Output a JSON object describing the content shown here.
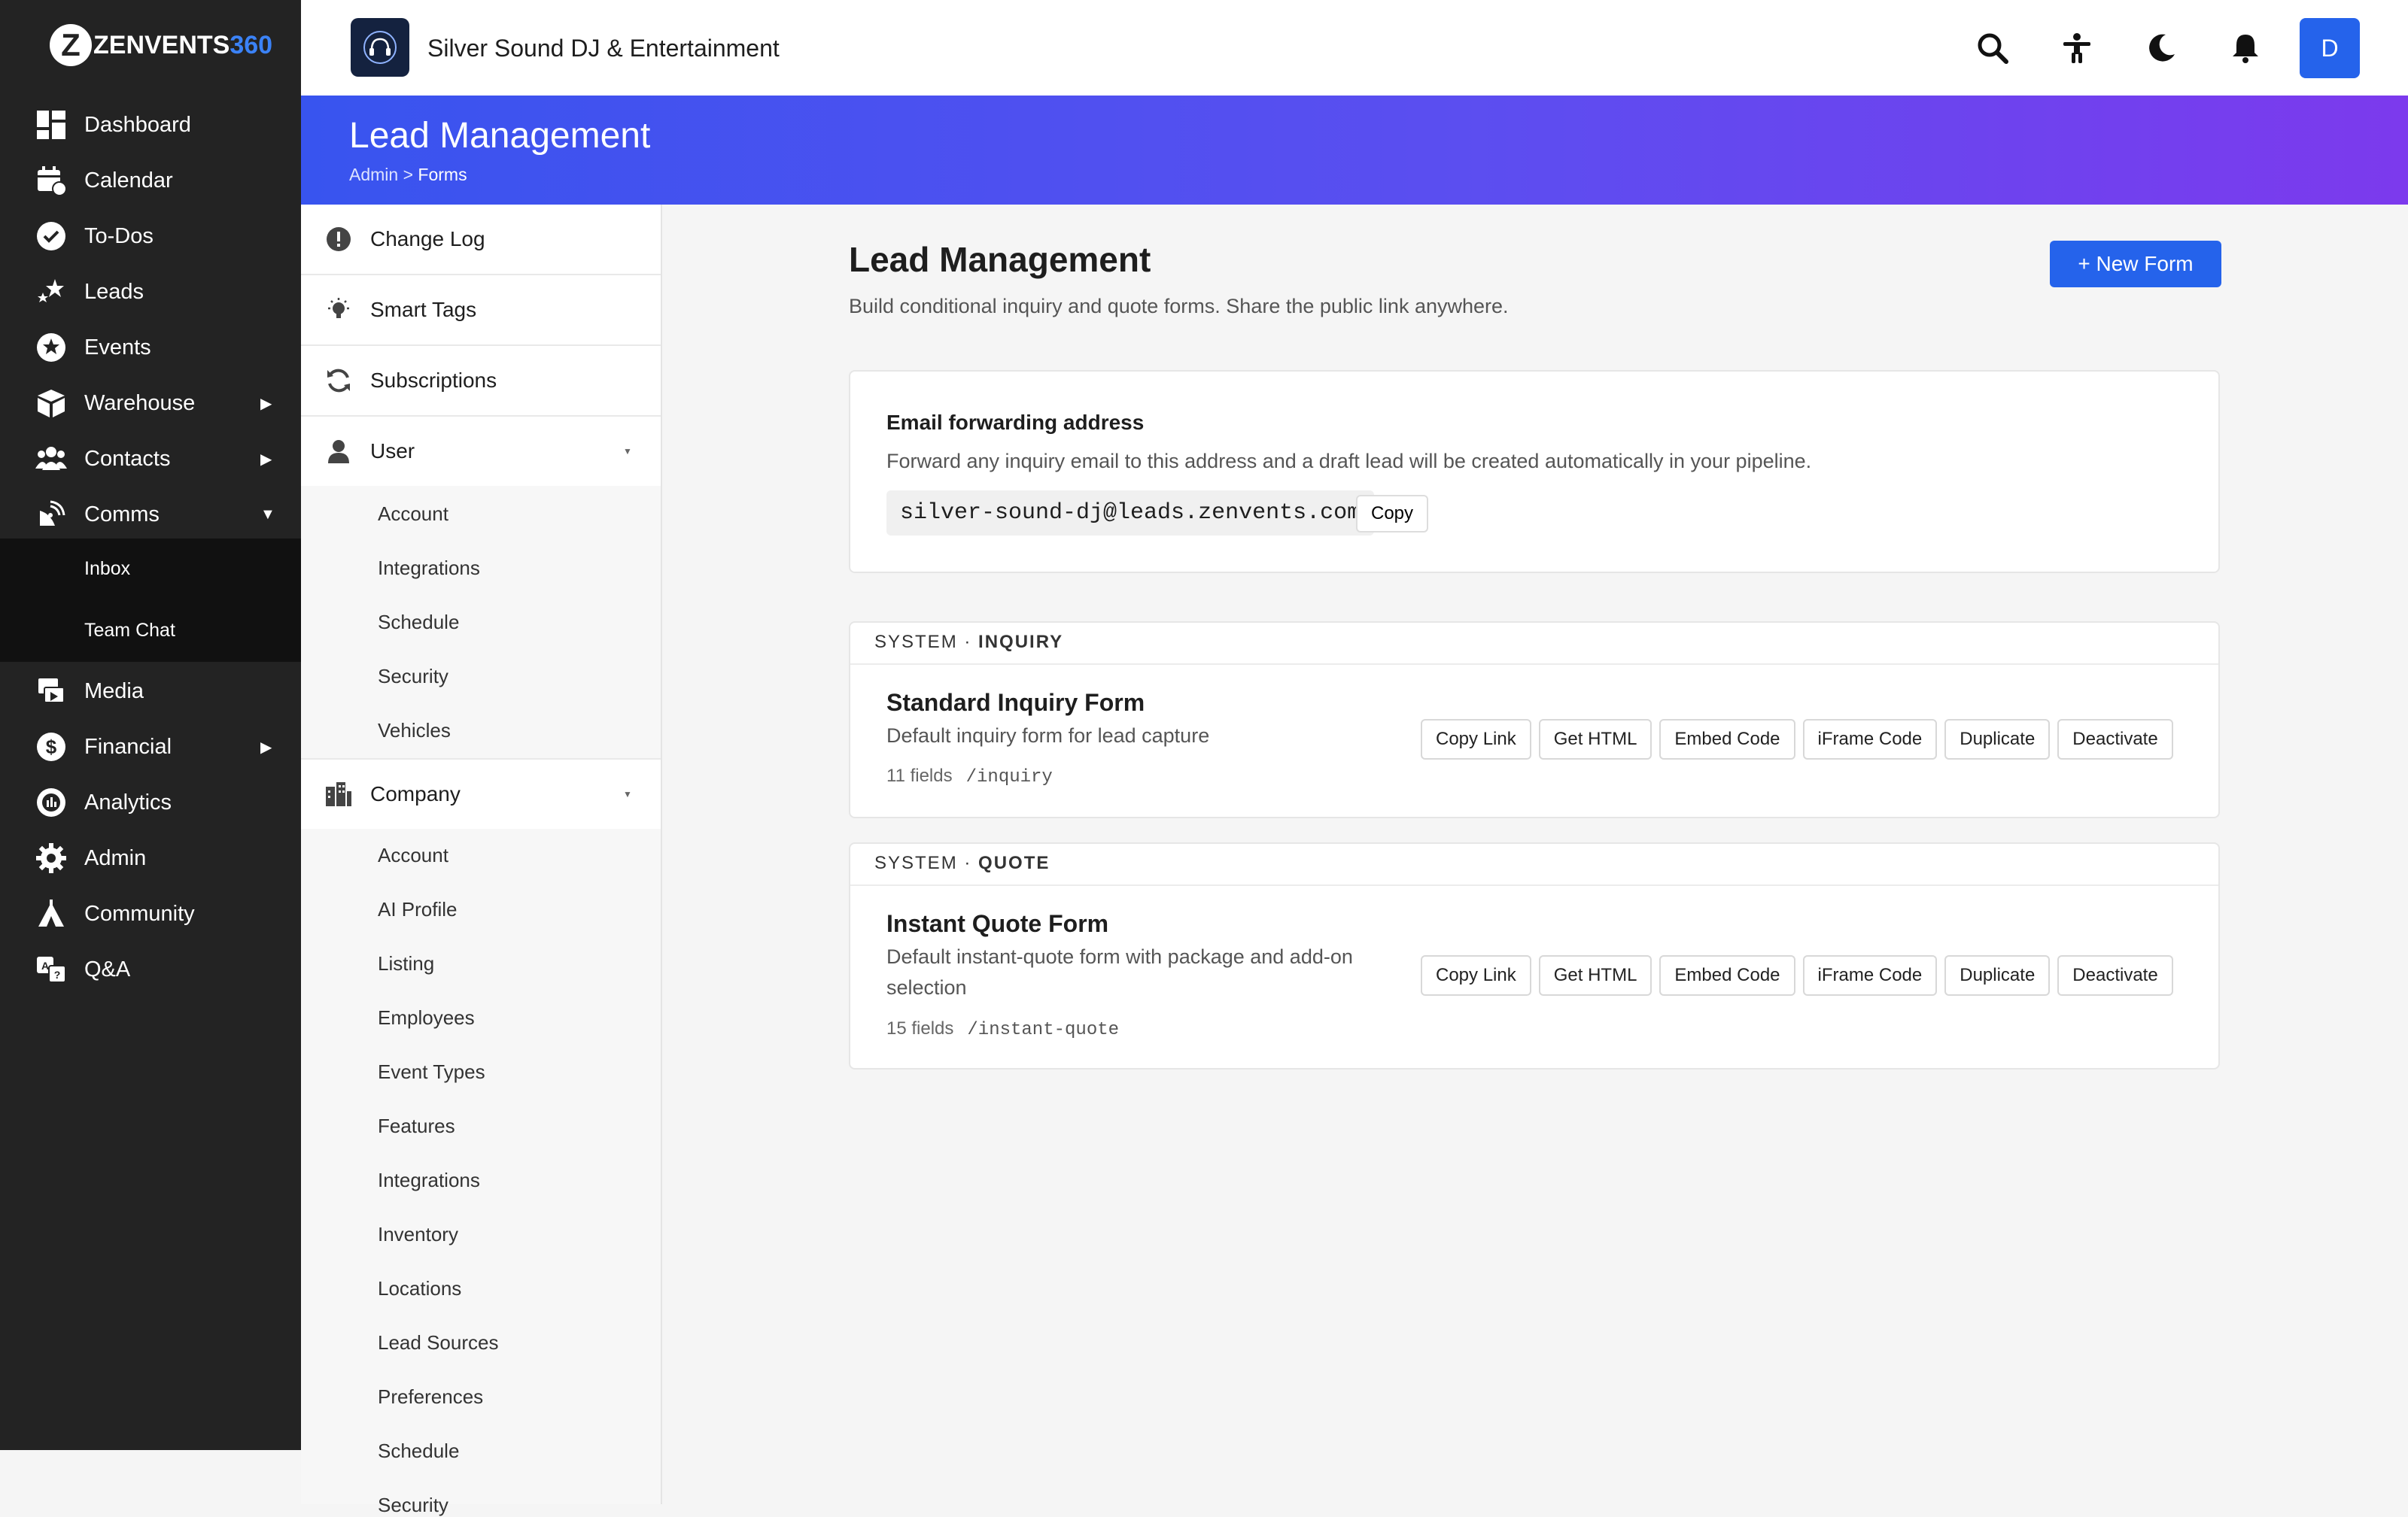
{
  "brand": {
    "logo_letter": "Z",
    "name": "ZENVENTS",
    "name_suffix": "360",
    "accent": "#3b82f6"
  },
  "sidebar": {
    "items": [
      {
        "label": "Dashboard",
        "icon": "dashboard-icon"
      },
      {
        "label": "Calendar",
        "icon": "calendar-icon"
      },
      {
        "label": "To-Dos",
        "icon": "check-circle-icon"
      },
      {
        "label": "Leads",
        "icon": "stars-icon"
      },
      {
        "label": "Events",
        "icon": "star-circle-icon"
      },
      {
        "label": "Warehouse",
        "icon": "box-icon",
        "arrow": "▶"
      },
      {
        "label": "Contacts",
        "icon": "users-icon",
        "arrow": "▶"
      },
      {
        "label": "Comms",
        "icon": "satellite-icon",
        "arrow": "▼"
      },
      {
        "label": "Media",
        "icon": "photo-video-icon"
      },
      {
        "label": "Financial",
        "icon": "dollar-icon",
        "arrow": "▶"
      },
      {
        "label": "Analytics",
        "icon": "chart-pie-icon"
      },
      {
        "label": "Admin",
        "icon": "gear-icon"
      },
      {
        "label": "Community",
        "icon": "campground-icon"
      },
      {
        "label": "Q&A",
        "icon": "language-icon"
      }
    ],
    "comms_sub": [
      "Inbox",
      "Team Chat"
    ]
  },
  "topbar": {
    "company_name": "Silver Sound DJ & Entertainment",
    "avatar_letter": "D",
    "icons": [
      "search-icon",
      "accessibility-icon",
      "moon-icon",
      "bell-icon"
    ]
  },
  "header": {
    "title": "Lead Management",
    "breadcrumb": {
      "parent": "Admin",
      "separator": ">",
      "current": "Forms"
    },
    "gradient": [
      "#3854ef",
      "#7c3aed"
    ]
  },
  "settings": {
    "top_items": [
      "Change Log",
      "Smart Tags",
      "Subscriptions"
    ],
    "user": {
      "label": "User",
      "caret": "▼",
      "items": [
        "Account",
        "Integrations",
        "Schedule",
        "Security",
        "Vehicles"
      ]
    },
    "company": {
      "label": "Company",
      "caret": "▼",
      "items": [
        "Account",
        "AI Profile",
        "Listing",
        "Employees",
        "Event Types",
        "Features",
        "Integrations",
        "Inventory",
        "Locations",
        "Lead Sources",
        "Preferences",
        "Schedule",
        "Security"
      ]
    }
  },
  "main": {
    "title": "Lead Management",
    "subtitle": "Build conditional inquiry and quote forms. Share the public link anywhere.",
    "new_form_label": "+ New Form",
    "email_card": {
      "title": "Email forwarding address",
      "description": "Forward any inquiry email to this address and a draft lead will be created automatically in your pipeline.",
      "address": "silver-sound-dj@leads.zenvents.com",
      "copy_label": "Copy"
    },
    "forms": [
      {
        "tag_prefix": "SYSTEM",
        "tag_dot": "·",
        "tag_type": "INQUIRY",
        "title": "Standard Inquiry Form",
        "description": "Default inquiry form for lead capture",
        "fields": "11 fields",
        "path": "/inquiry",
        "actions": [
          "Copy Link",
          "Get HTML",
          "Embed Code",
          "iFrame Code",
          "Duplicate",
          "Deactivate"
        ]
      },
      {
        "tag_prefix": "SYSTEM",
        "tag_dot": "·",
        "tag_type": "QUOTE",
        "title": "Instant Quote Form",
        "description": "Default instant-quote form with package and add-on selection",
        "fields": "15 fields",
        "path": "/instant-quote",
        "actions": [
          "Copy Link",
          "Get HTML",
          "Embed Code",
          "iFrame Code",
          "Duplicate",
          "Deactivate"
        ]
      }
    ]
  }
}
